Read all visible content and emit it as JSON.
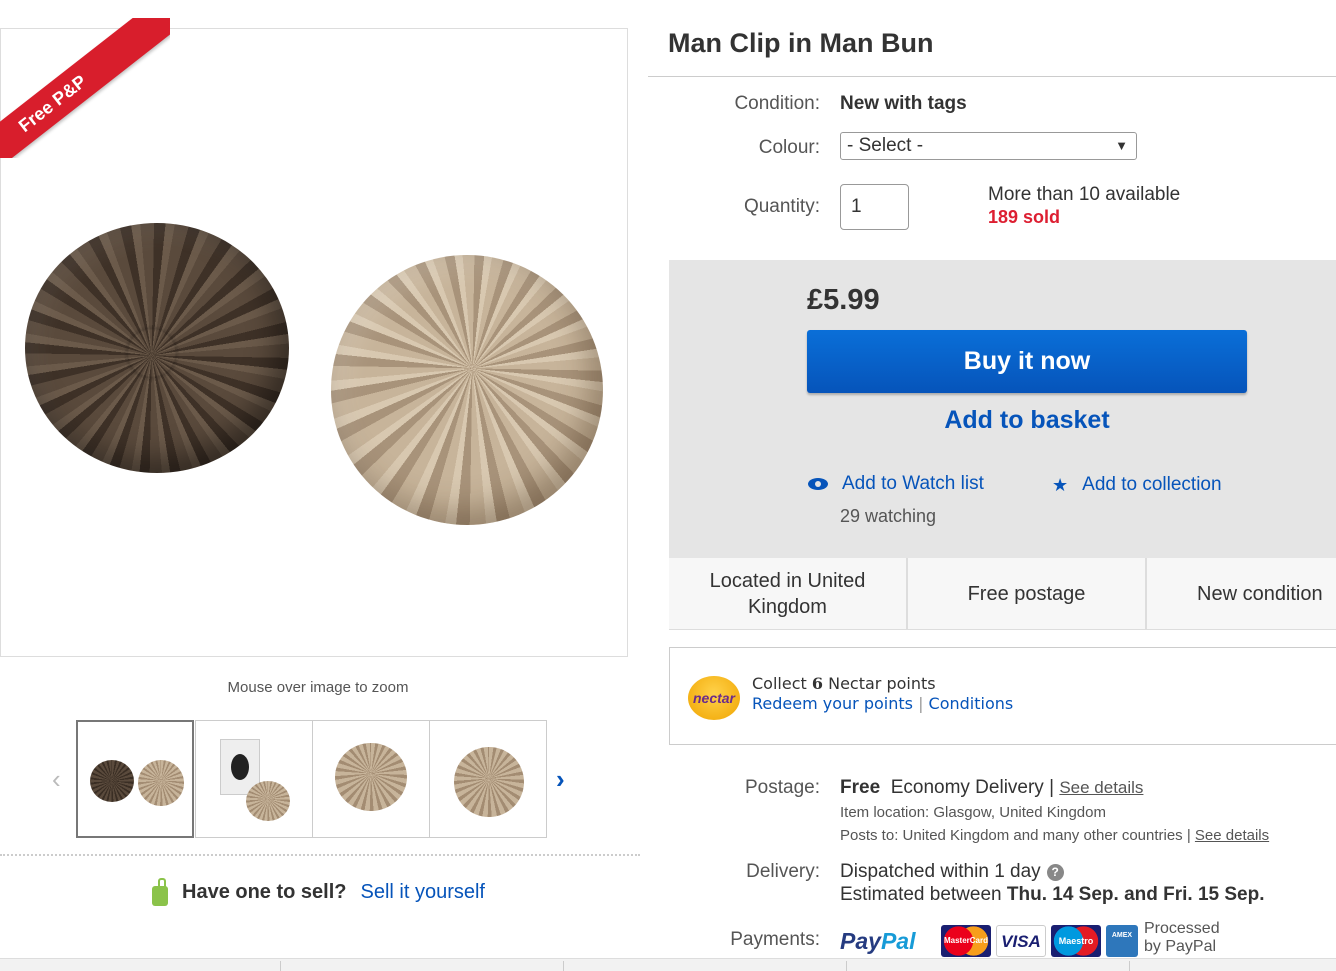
{
  "gallery": {
    "badge": "Free P&P",
    "zoom_hint": "Mouse over image to zoom",
    "prev_icon": "‹",
    "next_icon": "›"
  },
  "sell": {
    "question": "Have one to sell?",
    "link": "Sell it yourself"
  },
  "listing": {
    "title": "Man Clip in Man Bun",
    "condition_label": "Condition:",
    "condition_value": "New with tags",
    "colour_label": "Colour:",
    "colour_selected": "- Select -",
    "quantity_label": "Quantity:",
    "quantity_value": "1",
    "availability": "More than 10 available",
    "sold": "189 sold"
  },
  "buybox": {
    "price": "£5.99",
    "buy_now": "Buy it now",
    "add_to_basket": "Add to basket",
    "watch_list": "Add to Watch list",
    "watching": "29 watching",
    "collection": "Add to collection",
    "star_icon": "★"
  },
  "highlights": [
    "Located in United Kingdom",
    "Free postage",
    "New condition"
  ],
  "nectar": {
    "logo": "nectar",
    "collect_prefix": "Collect",
    "points": "6",
    "collect_suffix": "Nectar points",
    "redeem": "Redeem your points",
    "separator": "|",
    "conditions": "Conditions"
  },
  "postage": {
    "label": "Postage:",
    "free": "Free",
    "service": "Economy Delivery",
    "separator": "|",
    "see_details": "See details",
    "item_location": "Item location:  Glasgow, United Kingdom",
    "posts_to": "Posts to:  United Kingdom and many other countries",
    "see_details_2": "See details"
  },
  "delivery": {
    "label": "Delivery:",
    "dispatched": "Dispatched within 1 day",
    "help": "?",
    "estimated_prefix": "Estimated between",
    "estimated_range": "Thu. 14 Sep. and Fri. 15 Sep."
  },
  "payments": {
    "label": "Payments:",
    "paypal_1": "Pay",
    "paypal_2": "Pal",
    "cards": [
      "MasterCard",
      "VISA",
      "Maestro",
      "AMEX"
    ],
    "processed_1": "Processed",
    "processed_2": "by PayPal"
  },
  "colors": {
    "link_blue": "#0654ba",
    "sold_red": "#dd1e31",
    "badge_red": "#d81e2c",
    "buybox_grey": "#e5e5e5"
  }
}
